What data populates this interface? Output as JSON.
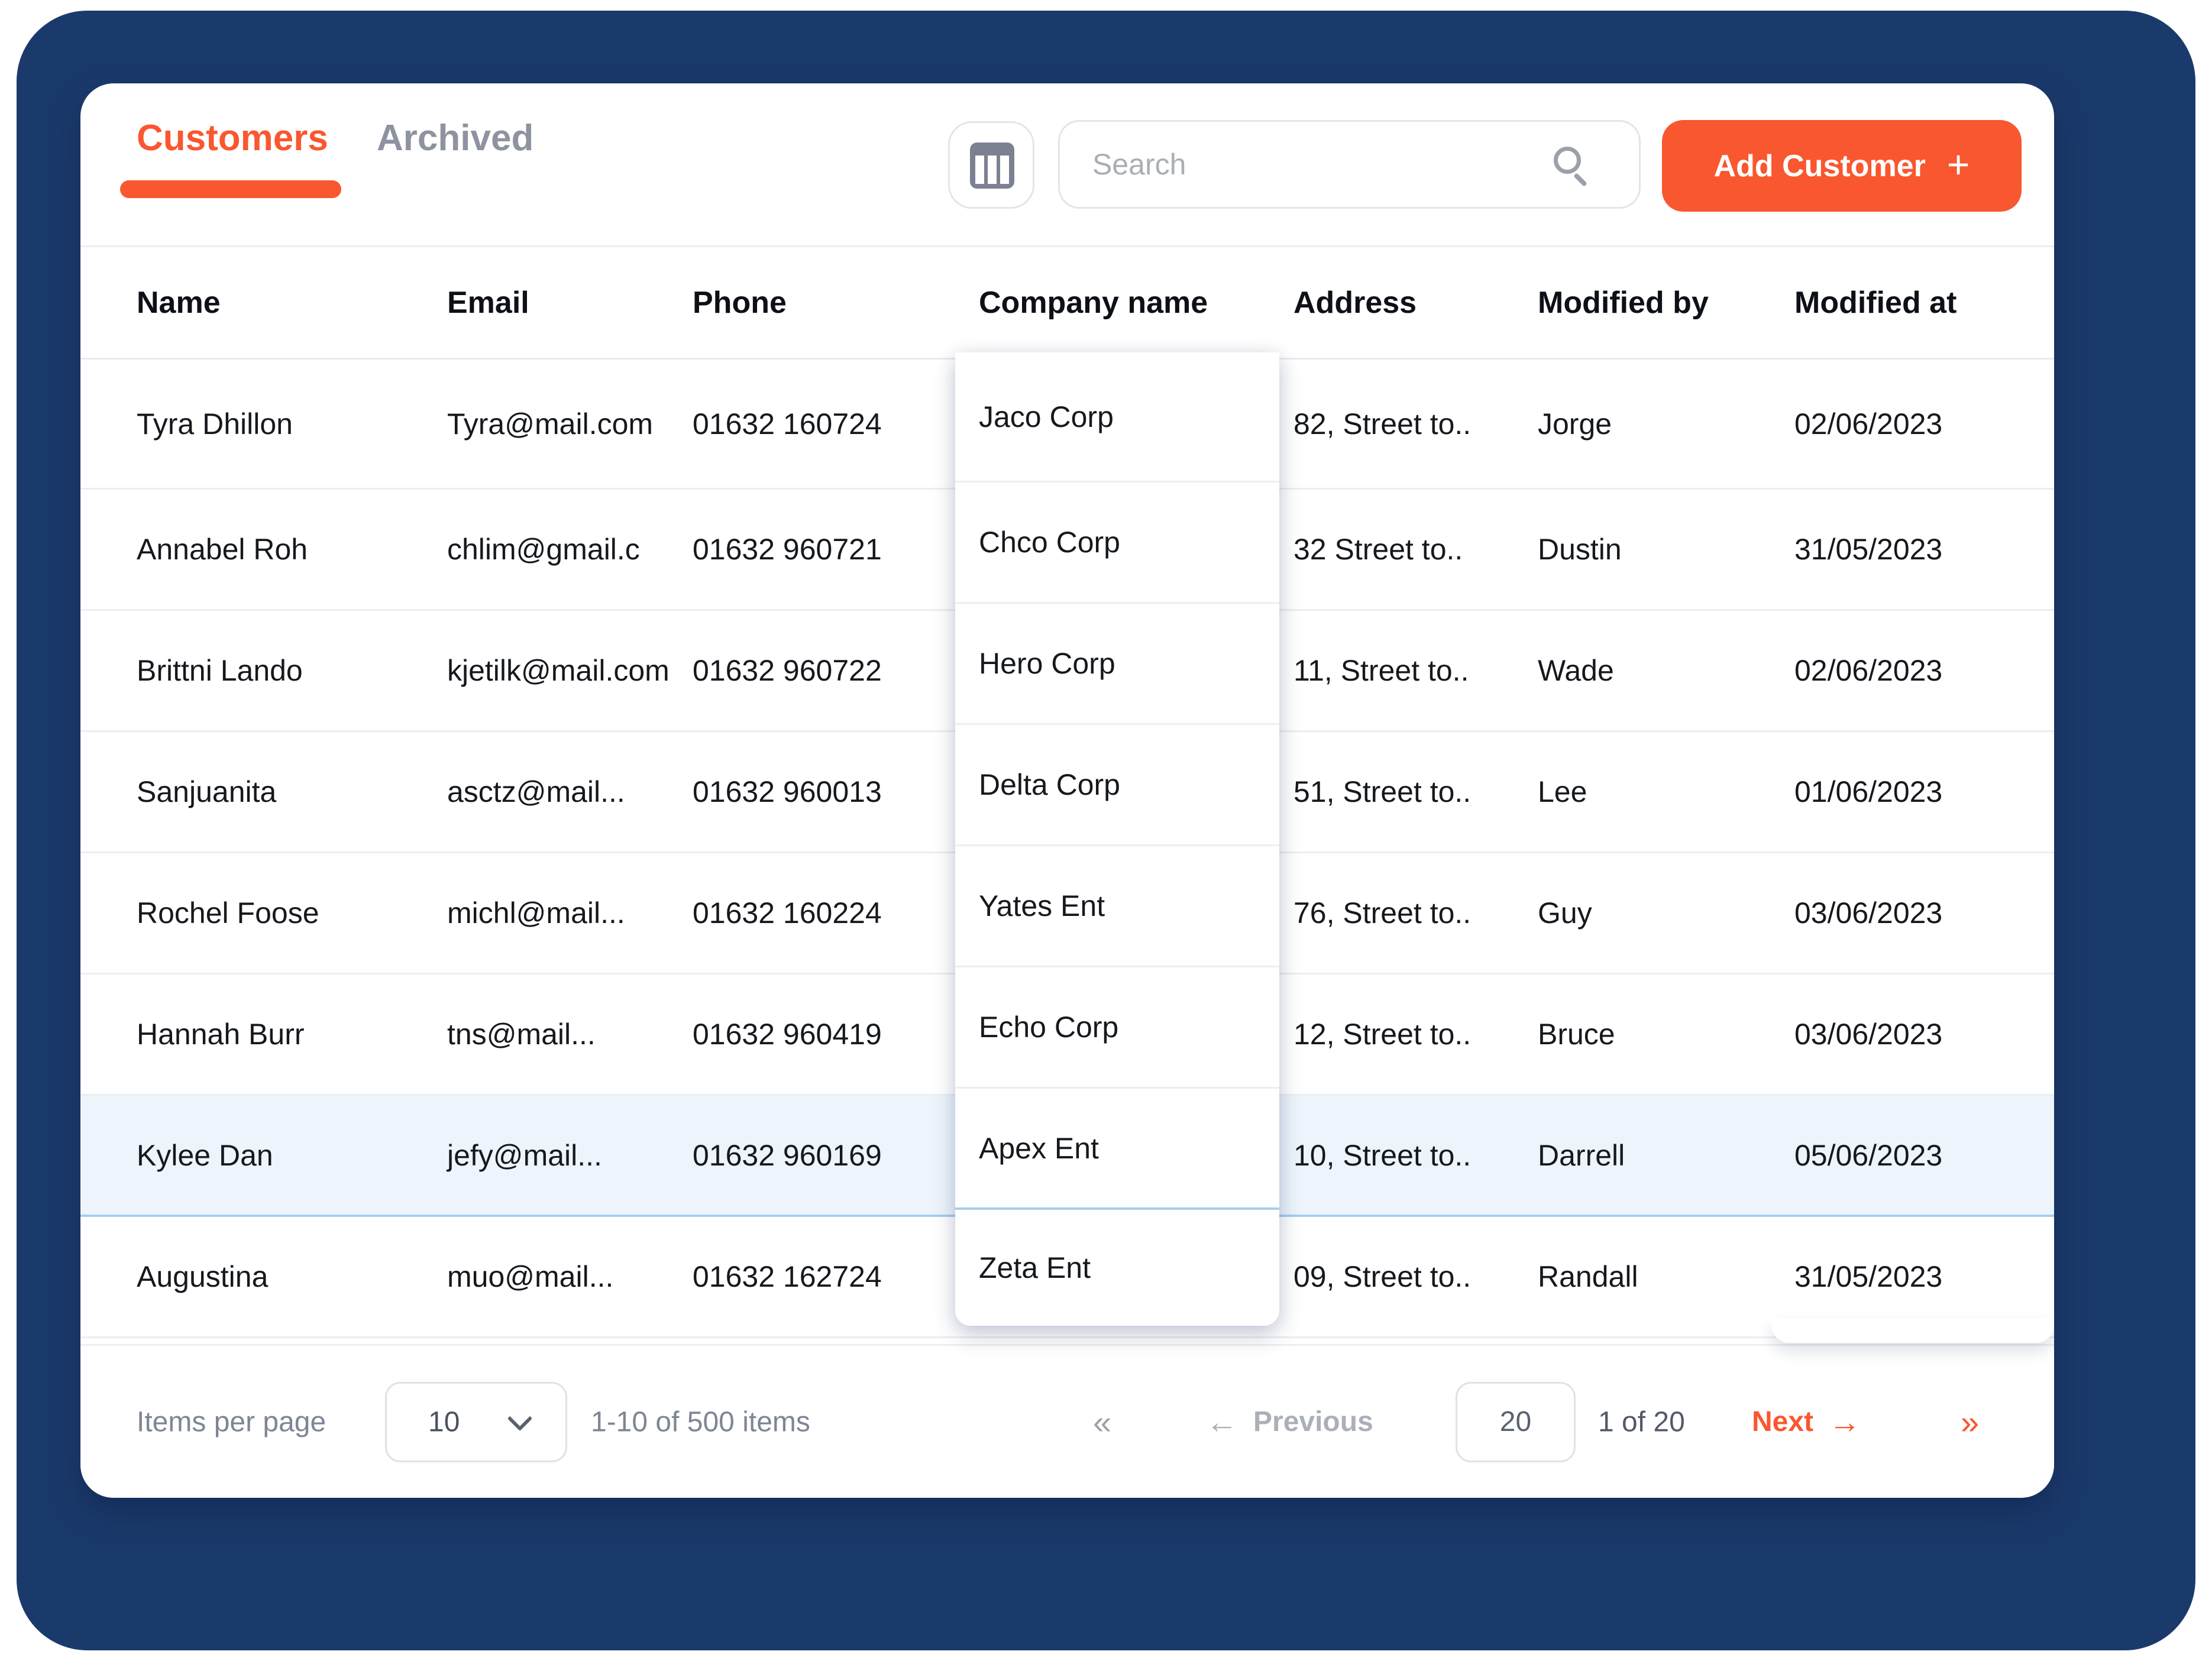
{
  "tabs": [
    {
      "label": "Customers",
      "active": true
    },
    {
      "label": "Archived",
      "active": false
    }
  ],
  "toolbar": {
    "columns_button_icon": "table-columns-icon",
    "search_placeholder": "Search",
    "search_icon": "magnifier-icon",
    "add_button_label": "Add Customer",
    "add_button_plus": "+"
  },
  "table": {
    "columns": {
      "name": "Name",
      "email": "Email",
      "phone": "Phone",
      "company": "Company name",
      "address": "Address",
      "modified_by": "Modified by",
      "modified_at": "Modified at"
    },
    "rows": [
      {
        "name": "Tyra Dhillon",
        "email": "Tyra@mail.com",
        "phone": "01632 160724",
        "company": "Jaco Corp",
        "address": "82, Street to..",
        "modified_by": "Jorge",
        "modified_at": "02/06/2023",
        "highlighted": false
      },
      {
        "name": "Annabel Roh",
        "email": "chlim@gmail.c",
        "phone": "01632 960721",
        "company": "Chco Corp",
        "address": "32 Street to..",
        "modified_by": "Dustin",
        "modified_at": "31/05/2023",
        "highlighted": false
      },
      {
        "name": "Brittni Lando",
        "email": "kjetilk@mail.com",
        "phone": "01632 960722",
        "company": "Hero Corp",
        "address": "11, Street to..",
        "modified_by": "Wade",
        "modified_at": "02/06/2023",
        "highlighted": false
      },
      {
        "name": "Sanjuanita",
        "email": "asctz@mail...",
        "phone": "01632 960013",
        "company": "Delta Corp",
        "address": "51, Street to..",
        "modified_by": "Lee",
        "modified_at": "01/06/2023",
        "highlighted": false
      },
      {
        "name": "Rochel Foose",
        "email": "michl@mail...",
        "phone": "01632 160224",
        "company": "Yates Ent",
        "address": "76, Street to..",
        "modified_by": "Guy",
        "modified_at": "03/06/2023",
        "highlighted": false
      },
      {
        "name": "Hannah Burr",
        "email": "tns@mail...",
        "phone": "01632 960419",
        "company": "Echo Corp",
        "address": "12, Street to..",
        "modified_by": "Bruce",
        "modified_at": "03/06/2023",
        "highlighted": false
      },
      {
        "name": "Kylee Dan",
        "email": "jefy@mail...",
        "phone": "01632 960169",
        "company": "Apex Ent",
        "address": "10, Street to..",
        "modified_by": "Darrell",
        "modified_at": "05/06/2023",
        "highlighted": true
      },
      {
        "name": "Augustina",
        "email": "muo@mail...",
        "phone": "01632 162724",
        "company": "Zeta Ent",
        "address": "09, Street to..",
        "modified_by": "Randall",
        "modified_at": "31/05/2023",
        "highlighted": false
      }
    ]
  },
  "footer": {
    "items_per_page_label": "Items per page",
    "items_per_page_value": "10",
    "range_text": "1-10 of 500 items",
    "first_icon": "«",
    "prev_arrow": "←",
    "prev_label": "Previous",
    "page_input_value": "20",
    "page_status": "1 of 20",
    "next_label": "Next",
    "next_arrow": "→",
    "last_icon": "»"
  },
  "colors": {
    "accent_orange": "#F95730",
    "frame_navy": "#1B3A6C",
    "row_highlight_bg": "#EDF4FB",
    "row_highlight_border": "#A6CEF1",
    "border_gray": "#EDEEF0",
    "muted_text": "#7E8694"
  }
}
